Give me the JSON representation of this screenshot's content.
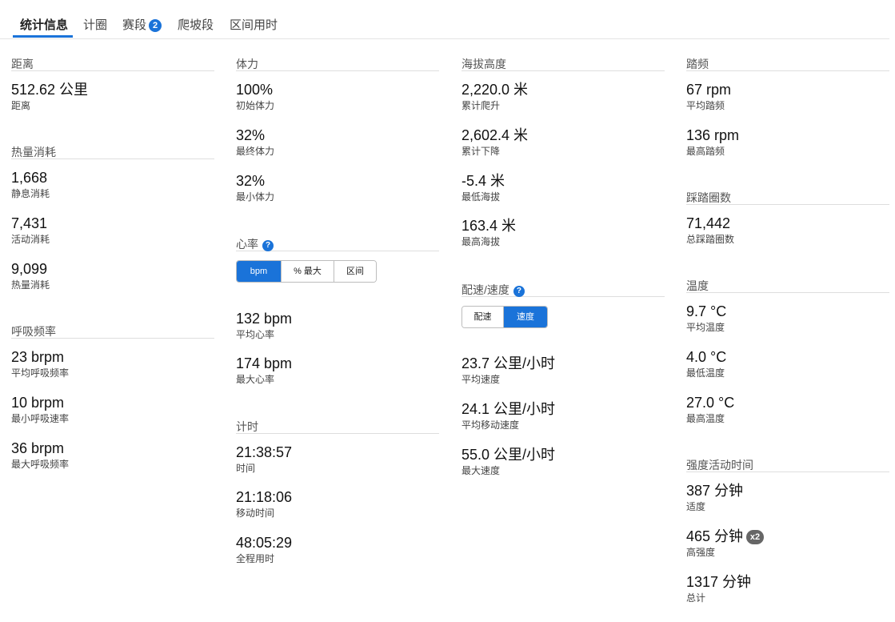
{
  "tabs": [
    {
      "label": "统计信息"
    },
    {
      "label": "计圈"
    },
    {
      "label": "赛段",
      "badge": "2"
    },
    {
      "label": "爬坡段"
    },
    {
      "label": "区间用时"
    }
  ],
  "distance": {
    "title": "距离",
    "stats": [
      {
        "value": "512.62 公里",
        "label": "距离"
      }
    ]
  },
  "calories": {
    "title": "热量消耗",
    "stats": [
      {
        "value": "1,668",
        "label": "静息消耗"
      },
      {
        "value": "7,431",
        "label": "活动消耗"
      },
      {
        "value": "9,099",
        "label": "热量消耗"
      }
    ]
  },
  "respiration": {
    "title": "呼吸频率",
    "stats": [
      {
        "value": "23 brpm",
        "label": "平均呼吸频率"
      },
      {
        "value": "10 brpm",
        "label": "最小呼吸速率"
      },
      {
        "value": "36 brpm",
        "label": "最大呼吸频率"
      }
    ]
  },
  "stamina": {
    "title": "体力",
    "stats": [
      {
        "value": "100%",
        "label": "初始体力"
      },
      {
        "value": "32%",
        "label": "最终体力"
      },
      {
        "value": "32%",
        "label": "最小体力"
      }
    ]
  },
  "heart_rate": {
    "title": "心率",
    "help": "?",
    "toggle": [
      "bpm",
      "% 最大",
      "区间"
    ],
    "active": "bpm",
    "stats": [
      {
        "value": "132 bpm",
        "label": "平均心率"
      },
      {
        "value": "174 bpm",
        "label": "最大心率"
      }
    ]
  },
  "timing": {
    "title": "计时",
    "stats": [
      {
        "value": "21:38:57",
        "label": "时间"
      },
      {
        "value": "21:18:06",
        "label": "移动时间"
      },
      {
        "value": "48:05:29",
        "label": "全程用时"
      }
    ]
  },
  "elevation": {
    "title": "海拔高度",
    "stats": [
      {
        "value": "2,220.0 米",
        "label": "累计爬升"
      },
      {
        "value": "2,602.4 米",
        "label": "累计下降"
      },
      {
        "value": "-5.4 米",
        "label": "最低海拔"
      },
      {
        "value": "163.4 米",
        "label": "最高海拔"
      }
    ]
  },
  "pace_speed": {
    "title": "配速/速度",
    "help": "?",
    "toggle": [
      "配速",
      "速度"
    ],
    "active": "速度",
    "stats": [
      {
        "value": "23.7 公里/小时",
        "label": "平均速度"
      },
      {
        "value": "24.1 公里/小时",
        "label": "平均移动速度"
      },
      {
        "value": "55.0 公里/小时",
        "label": "最大速度"
      }
    ]
  },
  "cadence": {
    "title": "踏频",
    "stats": [
      {
        "value": "67 rpm",
        "label": "平均踏频"
      },
      {
        "value": "136 rpm",
        "label": "最高踏频"
      }
    ]
  },
  "strokes": {
    "title": "踩踏圈数",
    "stats": [
      {
        "value": "71,442",
        "label": "总踩踏圈数"
      }
    ]
  },
  "temperature": {
    "title": "温度",
    "stats": [
      {
        "value": "9.7 °C",
        "label": "平均温度"
      },
      {
        "value": "4.0 °C",
        "label": "最低温度"
      },
      {
        "value": "27.0 °C",
        "label": "最高温度"
      }
    ]
  },
  "intensity": {
    "title": "强度活动时间",
    "stats": [
      {
        "value": "387 分钟",
        "label": "适度"
      },
      {
        "value": "465 分钟",
        "label": "高强度",
        "badge": "x2"
      },
      {
        "value": "1317 分钟",
        "label": "总计"
      }
    ]
  }
}
